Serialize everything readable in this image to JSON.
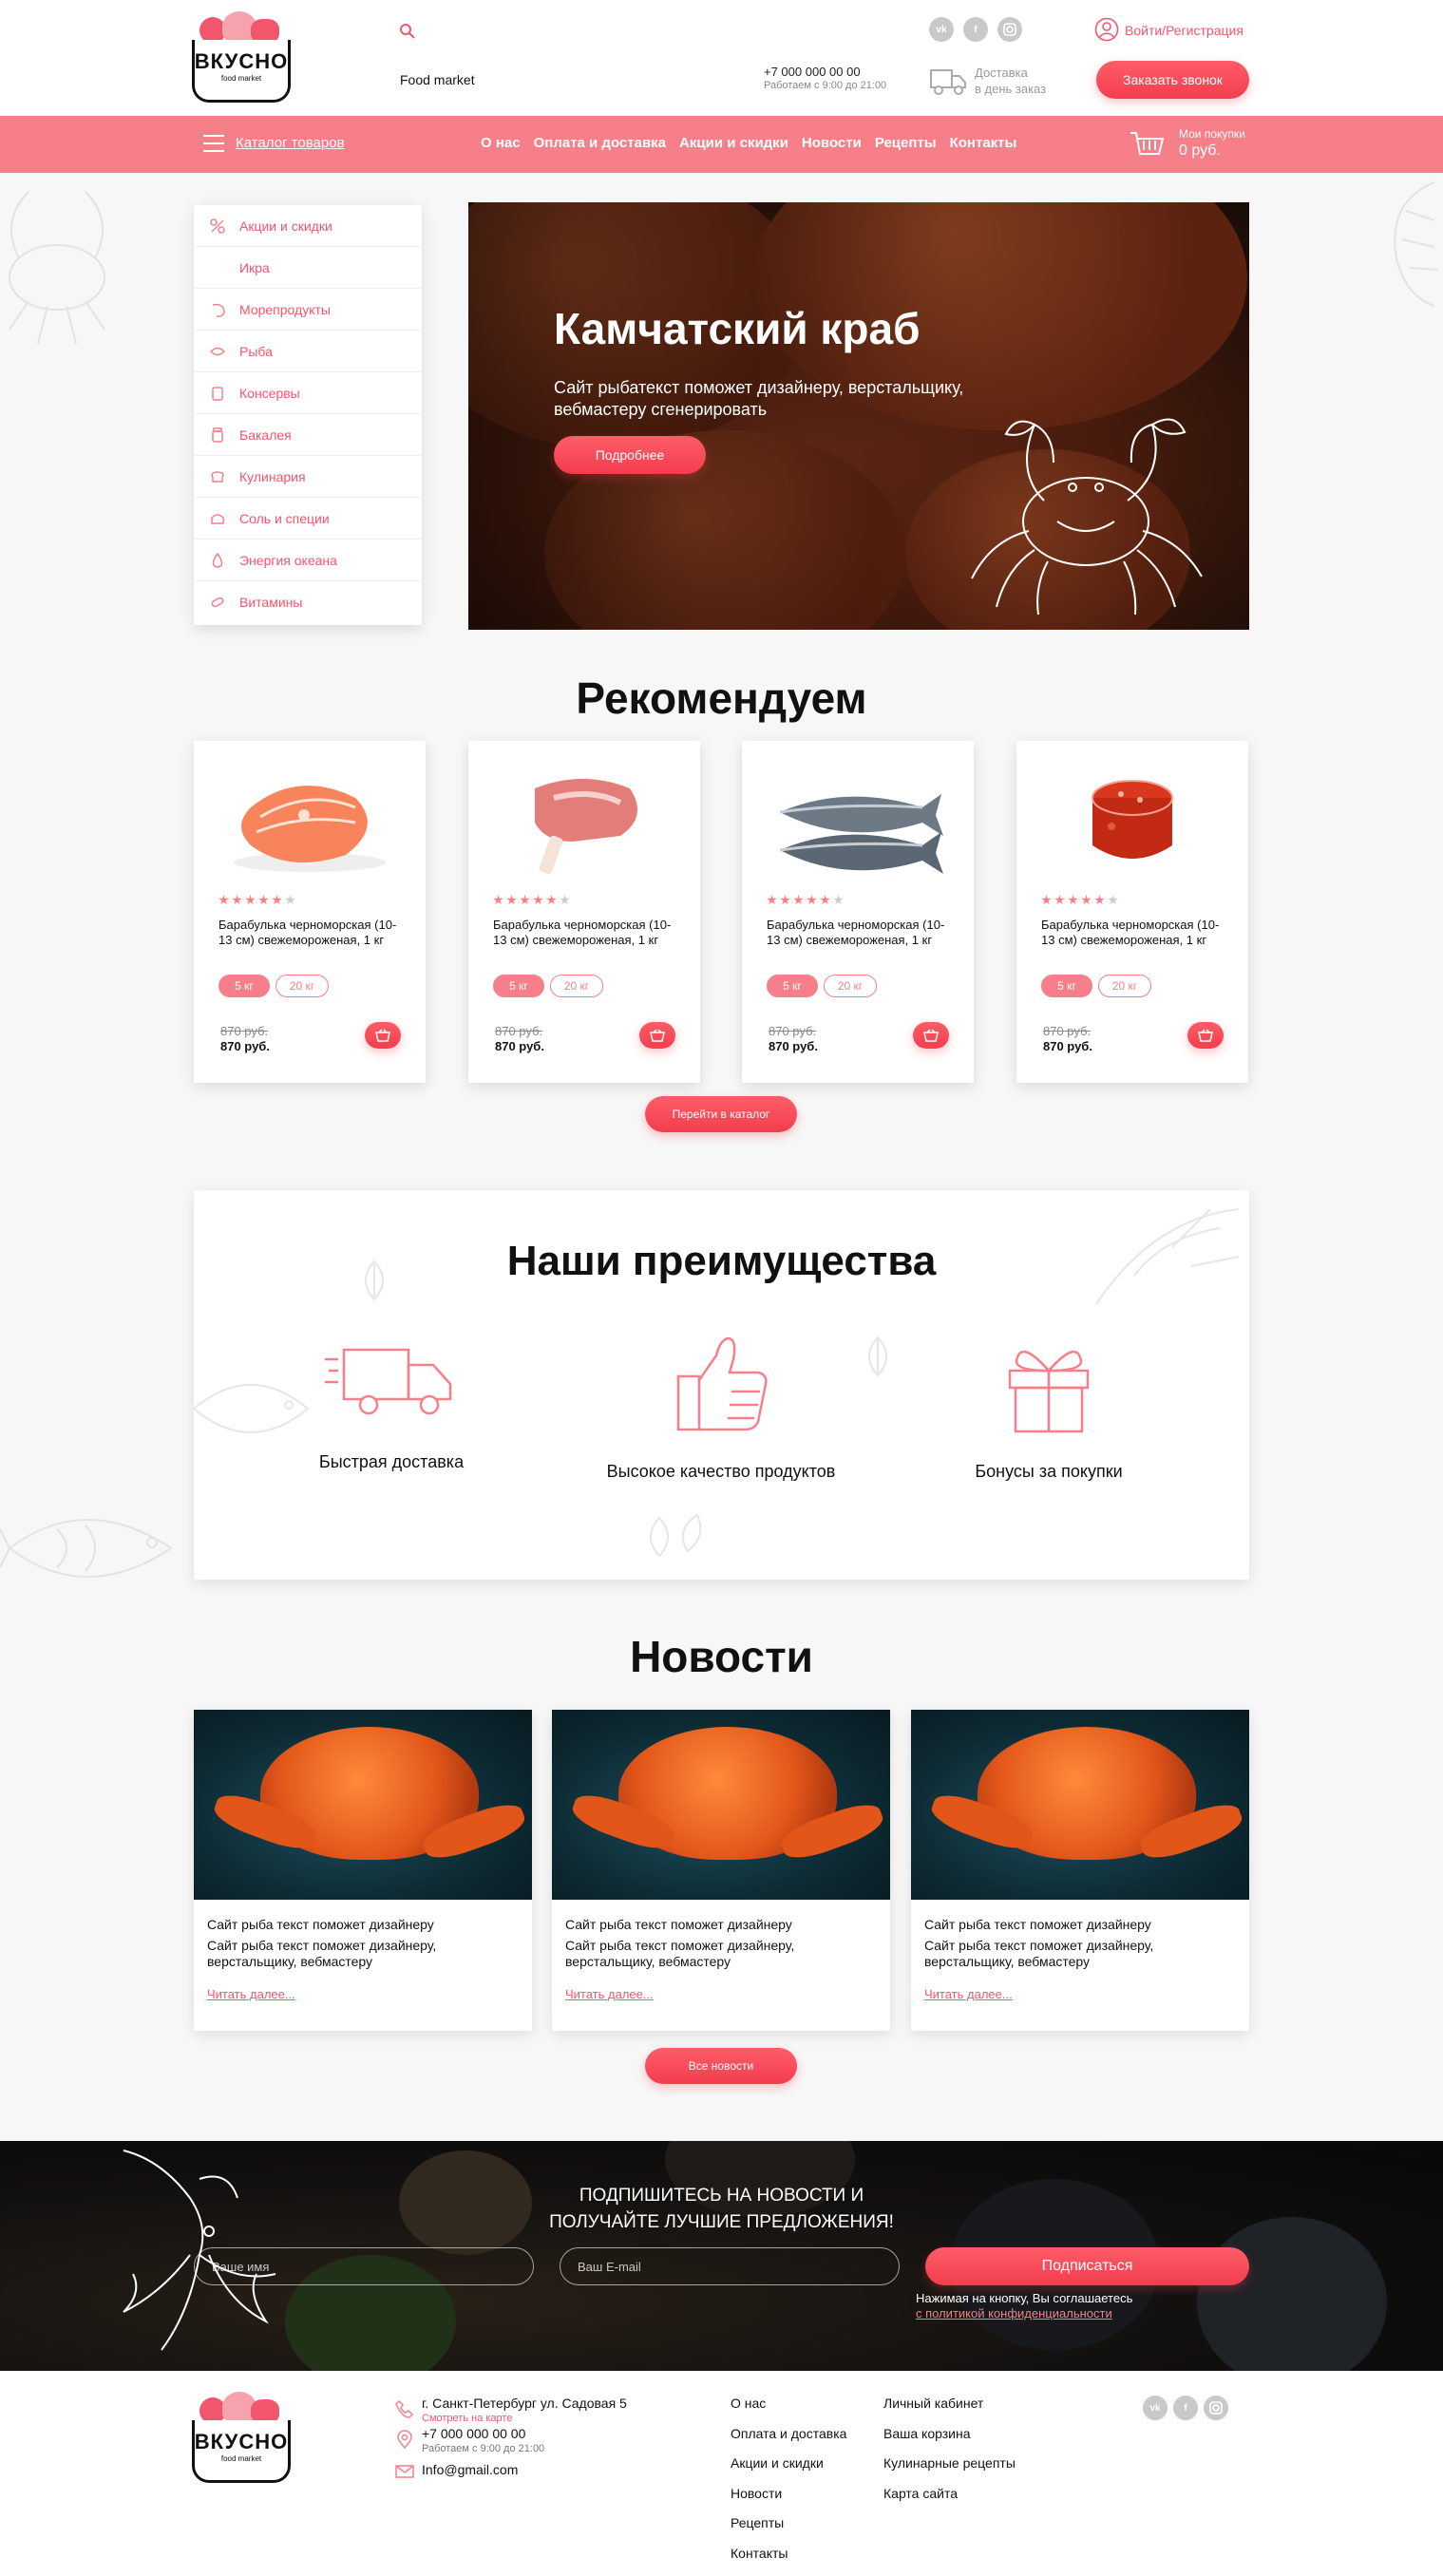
{
  "header": {
    "logo_text": "ВКУСНО",
    "logo_sub": "food market",
    "tagline": "Food market",
    "phone": "+7 000 000 00 00",
    "hours": "Работаем с 9:00 до 21:00",
    "social": [
      "vk-icon",
      "facebook-icon",
      "instagram-icon"
    ],
    "delivery_line1": "Доставка",
    "delivery_line2": "в день заказ",
    "login": "Войти/Регистрация",
    "callback": "Заказать звонок"
  },
  "nav": {
    "catalog": "Каталог товаров",
    "links": [
      "О нас",
      "Оплата и доставка",
      "Акции и скидки",
      "Новости",
      "Рецепты",
      "Контакты"
    ],
    "cart_label": "Мои покупки",
    "cart_total": "0 руб."
  },
  "sidebar": {
    "items": [
      {
        "label": "Акции и скидки",
        "icon": "percent-icon"
      },
      {
        "label": "Икра",
        "icon": ""
      },
      {
        "label": "Морепродукты",
        "icon": "shrimp-icon"
      },
      {
        "label": "Рыба",
        "icon": "fish-icon"
      },
      {
        "label": "Консервы",
        "icon": "can-icon"
      },
      {
        "label": "Бакалея",
        "icon": "jar-icon"
      },
      {
        "label": "Кулинария",
        "icon": "chef-hat-icon"
      },
      {
        "label": "Соль и специи",
        "icon": "salt-icon"
      },
      {
        "label": "Энергия океана",
        "icon": "drop-icon"
      },
      {
        "label": "Витамины",
        "icon": "vitamin-icon"
      }
    ]
  },
  "hero": {
    "title": "Камчатский краб",
    "text": "Сайт рыбатекст поможет дизайнеру, верстальщику, вебмастеру сгенерировать",
    "button": "Подробнее"
  },
  "recommend": {
    "title": "Рекомендуем",
    "products": [
      {
        "name": "Барабулька черноморская (10-13 см) свежемороженая, 1 кг",
        "rating": 5,
        "weight1": "5 кг",
        "weight2": "20 кг",
        "old_price": "870 руб.",
        "price": "870 руб.",
        "image": "salmon-steak"
      },
      {
        "name": "Барабулька черноморская (10-13 см) свежемороженая, 1 кг",
        "rating": 5,
        "weight1": "5 кг",
        "weight2": "20 кг",
        "old_price": "870 руб.",
        "price": "870 руб.",
        "image": "meat-chop"
      },
      {
        "name": "Барабулька черноморская (10-13 см) свежемороженая, 1 кг",
        "rating": 5,
        "weight1": "5 кг",
        "weight2": "20 кг",
        "old_price": "870 руб.",
        "price": "870 руб.",
        "image": "whole-fish"
      },
      {
        "name": "Барабулька черноморская (10-13 см) свежемороженая, 1 кг",
        "rating": 5,
        "weight1": "5 кг",
        "weight2": "20 кг",
        "old_price": "870 руб.",
        "price": "870 руб.",
        "image": "red-caviar"
      }
    ],
    "catalog_button": "Перейти в каталог"
  },
  "advantages": {
    "title": "Наши преимущества",
    "items": [
      {
        "label": "Быстрая доставка",
        "icon": "truck-icon"
      },
      {
        "label": "Высокое качество продуктов",
        "icon": "thumbs-up-icon"
      },
      {
        "label": "Бонусы за покупки",
        "icon": "gift-icon"
      }
    ]
  },
  "news": {
    "title": "Новости",
    "items": [
      {
        "title": "Сайт рыба текст поможет дизайнеру",
        "text": "Сайт рыба текст поможет дизайнеру, верстальщику, вебмастеру",
        "more": "Читать далее..."
      },
      {
        "title": "Сайт рыба текст поможет дизайнеру",
        "text": "Сайт рыба текст поможет дизайнеру, верстальщику, вебмастеру",
        "more": "Читать далее..."
      },
      {
        "title": "Сайт рыба текст поможет дизайнеру",
        "text": "Сайт рыба текст поможет дизайнеру, верстальщику, вебмастеру",
        "more": "Читать далее..."
      }
    ],
    "all_button": "Все новости"
  },
  "subscribe": {
    "headline_line1": "ПОДПИШИТЕСЬ НА НОВОСТИ И",
    "headline_line2": "ПОЛУЧАЙТЕ ЛУЧШИЕ ПРЕДЛОЖЕНИЯ!",
    "name_placeholder": "Ваше имя",
    "email_placeholder": "Ваш E-mail",
    "button": "Подписаться",
    "agree": "Нажимая на кнопку, Вы соглашаетесь",
    "policy": "с политикой конфиденциальности"
  },
  "footer": {
    "address": "г. Санкт-Петербург ул. Садовая 5",
    "map_link": "Смотреть на карте",
    "phone": "+7 000 000 00 00",
    "hours": "Работаем с 9:00 до 21:00",
    "email": "Info@gmail.com",
    "col1": [
      "О нас",
      "Оплата и доставка",
      "Акции и скидки",
      "Новости",
      "Рецепты",
      "Контакты"
    ],
    "col2": [
      "Личный кабинет",
      "Ваша корзина",
      "Кулинарные рецепты",
      "Карта сайта"
    ]
  },
  "colors": {
    "accent": "#f2566c",
    "nav": "#f77f8a",
    "button": "#f33d4d"
  }
}
